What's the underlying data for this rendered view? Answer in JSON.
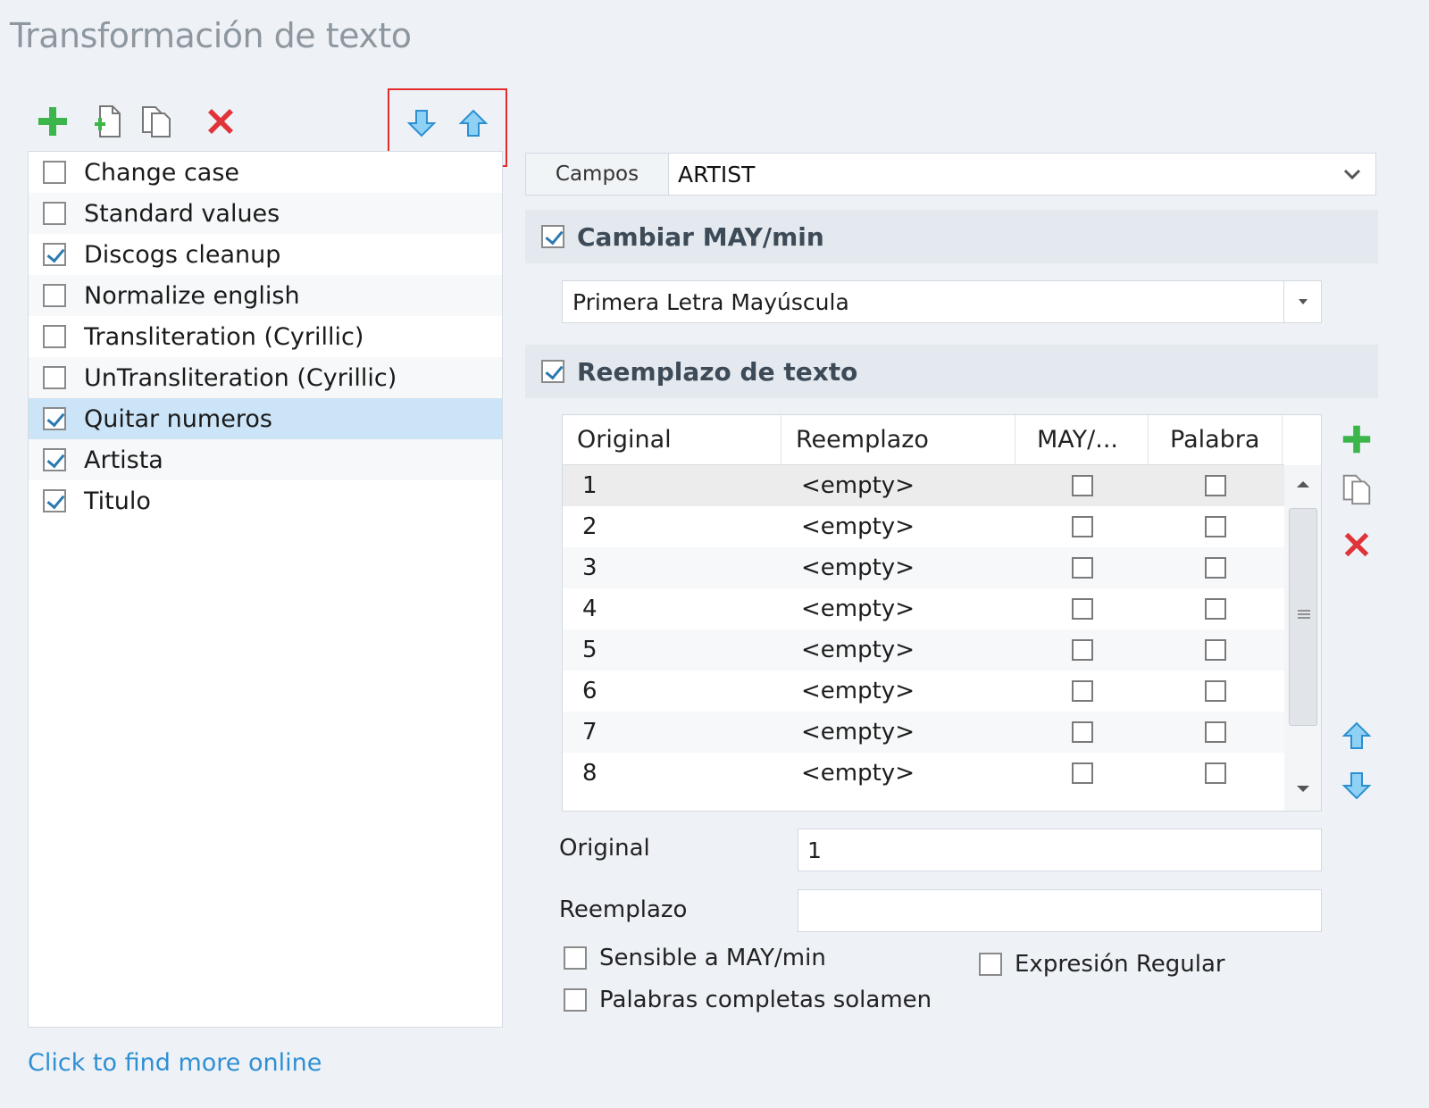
{
  "title": "Transformación de texto",
  "toolbar": {
    "add_icon": "plus-icon",
    "add_file_icon": "new-document-icon",
    "copy_icon": "copy-icon",
    "delete_icon": "delete-icon",
    "move_down_icon": "arrow-down-icon",
    "move_up_icon": "arrow-up-icon"
  },
  "presets": [
    {
      "label": "Change case",
      "checked": false
    },
    {
      "label": "Standard values",
      "checked": false
    },
    {
      "label": "Discogs cleanup",
      "checked": true
    },
    {
      "label": "Normalize english",
      "checked": false
    },
    {
      "label": "Transliteration (Cyrillic)",
      "checked": false
    },
    {
      "label": "UnTransliteration (Cyrillic)",
      "checked": false
    },
    {
      "label": "Quitar numeros",
      "checked": true,
      "selected": true
    },
    {
      "label": "Artista",
      "checked": true
    },
    {
      "label": "Titulo",
      "checked": true
    }
  ],
  "link": "Click to find more online",
  "fields": {
    "label": "Campos",
    "value": "ARTIST"
  },
  "change_case": {
    "title": "Cambiar MAY/min",
    "checked": true,
    "option": "Primera Letra Mayúscula"
  },
  "replace": {
    "title": "Reemplazo de texto",
    "checked": true,
    "columns": [
      "Original",
      "Reemplazo",
      "MAY/...",
      "Palabra"
    ],
    "rows": [
      {
        "original": "1",
        "replacement": "<empty>"
      },
      {
        "original": "2",
        "replacement": "<empty>"
      },
      {
        "original": "3",
        "replacement": "<empty>"
      },
      {
        "original": "4",
        "replacement": "<empty>"
      },
      {
        "original": "5",
        "replacement": "<empty>"
      },
      {
        "original": "6",
        "replacement": "<empty>"
      },
      {
        "original": "7",
        "replacement": "<empty>"
      },
      {
        "original": "8",
        "replacement": "<empty>"
      }
    ]
  },
  "form": {
    "original_label": "Original",
    "original_value": "1",
    "replacement_label": "Reemplazo",
    "replacement_value": "",
    "case_sensitive": "Sensible a MAY/min",
    "whole_words": "Palabras completas solamen",
    "regex": "Expresión Regular"
  },
  "colors": {
    "accent_blue": "#3aa0e0",
    "add_green": "#3cb54a",
    "delete_red": "#e0343a",
    "highlight_red": "#e32b2b"
  }
}
